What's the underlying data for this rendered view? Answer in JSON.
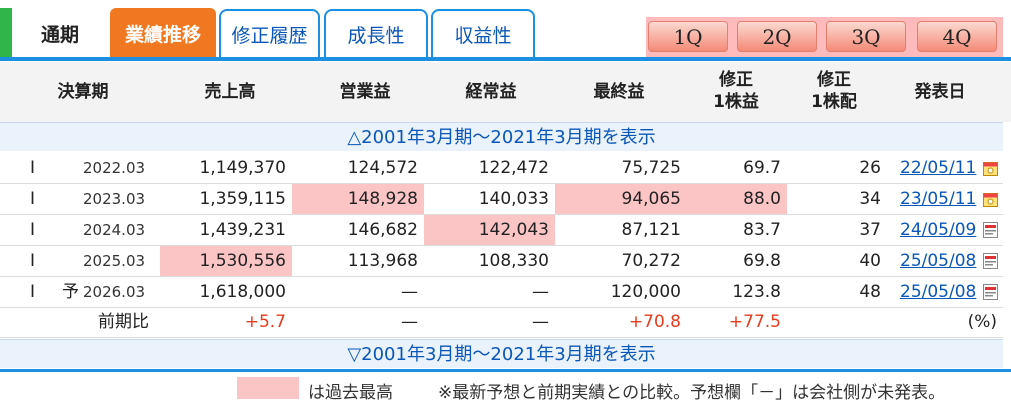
{
  "tabs": {
    "tsuki": "通期",
    "active": "業績推移",
    "shusei": "修正履歴",
    "seicho": "成長性",
    "shueki": "収益性"
  },
  "quarters": [
    "1Q",
    "2Q",
    "3Q",
    "4Q"
  ],
  "header": {
    "period": "決算期",
    "sales": "売上高",
    "op": "営業益",
    "ord": "経常益",
    "net": "最終益",
    "eps_l1": "修正",
    "eps_l2": "1株益",
    "div_l1": "修正",
    "div_l2": "1株配",
    "date": "発表日"
  },
  "toggle_top": "△2001年3月期～2021年3月期を表示",
  "toggle_bottom": "▽2001年3月期～2021年3月期を表示",
  "rows": [
    {
      "type": "I",
      "mark": "",
      "period": "2022.03",
      "sales": "1,149,370",
      "op": "124,572",
      "ord": "122,472",
      "net": "75,725",
      "eps": "69.7",
      "div": "26",
      "date": "22/05/11",
      "icon": "calendar-icon"
    },
    {
      "type": "I",
      "mark": "",
      "period": "2023.03",
      "sales": "1,359,115",
      "op": "148,928",
      "ord": "140,033",
      "net": "94,065",
      "eps": "88.0",
      "div": "34",
      "date": "23/05/11",
      "icon": "calendar-icon"
    },
    {
      "type": "I",
      "mark": "",
      "period": "2024.03",
      "sales": "1,439,231",
      "op": "146,682",
      "ord": "142,043",
      "net": "87,121",
      "eps": "83.7",
      "div": "37",
      "date": "24/05/09",
      "icon": "pdf-icon"
    },
    {
      "type": "I",
      "mark": "",
      "period": "2025.03",
      "sales": "1,530,556",
      "op": "113,968",
      "ord": "108,330",
      "net": "70,272",
      "eps": "69.8",
      "div": "40",
      "date": "25/05/08",
      "icon": "pdf-icon"
    },
    {
      "type": "I",
      "mark": "予",
      "period": "2026.03",
      "sales": "1,618,000",
      "op": "—",
      "ord": "—",
      "net": "120,000",
      "eps": "123.8",
      "div": "48",
      "date": "25/05/08",
      "icon": "pdf-icon"
    }
  ],
  "ratio": {
    "label": "前期比",
    "sales": "+5.7",
    "op": "—",
    "ord": "—",
    "net": "+70.8",
    "eps": "+77.5",
    "unit": "(%)"
  },
  "legend": {
    "text": "は過去最高",
    "note": "※最新予想と前期実績との比較。予想欄「－」は会社側が未発表。"
  },
  "colors": {
    "highlight": "#fcc5c5",
    "accent_tab": "#f07820",
    "tab_border": "#1d8fe0",
    "link": "#0a57b8",
    "positive": "#e53b1e"
  }
}
